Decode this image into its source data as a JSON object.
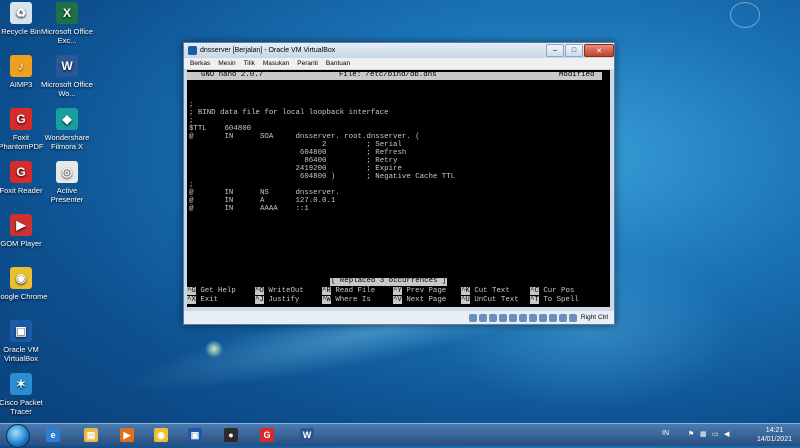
{
  "desktop": {
    "icons": [
      {
        "label": "Recycle Bin",
        "icon": "recycle-bin-icon",
        "color": "#d8e4ee",
        "glyph": "♻"
      },
      {
        "label": "Microsoft Office Exc...",
        "icon": "excel-icon",
        "color": "#1e7145",
        "glyph": "X"
      },
      {
        "label": "AIMP3",
        "icon": "aimp-icon",
        "color": "#f0a020",
        "glyph": "♪"
      },
      {
        "label": "Microsoft Office Wo...",
        "icon": "word-icon",
        "color": "#2b5797",
        "glyph": "W"
      },
      {
        "label": "Foxit PhantomPDF",
        "icon": "foxit-icon",
        "color": "#d62b2b",
        "glyph": "G"
      },
      {
        "label": "Wondershare Filmora X",
        "icon": "filmora-icon",
        "color": "#18a0a0",
        "glyph": "◆"
      },
      {
        "label": "Foxit Reader",
        "icon": "foxit-reader-icon",
        "color": "#d62b2b",
        "glyph": "G"
      },
      {
        "label": "Active Presenter",
        "icon": "active-presenter-icon",
        "color": "#e8e8e8",
        "glyph": "◎"
      },
      {
        "label": "GOM Player",
        "icon": "gom-player-icon",
        "color": "#d03030",
        "glyph": "▶"
      },
      {
        "label": "Google Chrome",
        "icon": "chrome-icon",
        "color": "#e8c030",
        "glyph": "◉"
      },
      {
        "label": "Oracle VM VirtualBox",
        "icon": "virtualbox-icon",
        "color": "#1c5aa8",
        "glyph": "▣"
      },
      {
        "label": "Cisco Packet Tracer",
        "icon": "packet-tracer-icon",
        "color": "#2a8fd0",
        "glyph": "✶"
      }
    ]
  },
  "window": {
    "title": "dnsserver [Berjalan] - Oracle VM VirtualBox",
    "menu": [
      "Berkas",
      "Mesin",
      "Tilik",
      "Masukan",
      "Peranti",
      "Bantuan"
    ],
    "host_key": "Right Ctrl"
  },
  "nano": {
    "version": "GNU nano 2.0.7",
    "file": "File: /etc/bind/db.dns",
    "state": "Modified",
    "lines": [
      ";",
      "; BIND data file for local loopback interface",
      ";",
      "$TTL    604800",
      "@       IN      SOA     dnsserver. root.dnsserver. (",
      "                              2         ; Serial",
      "                         604800         ; Refresh",
      "                          86400         ; Retry",
      "                        2419200         ; Expire",
      "                         604800 )       ; Negative Cache TTL",
      ";",
      "@       IN      NS      dnsserver.",
      "@       IN      A       127.0.0.1",
      "@       IN      AAAA    ::1"
    ],
    "status": "[ Replaced 3 occurrences ]",
    "help_row1": [
      {
        "key": "^G",
        "label": "Get Help"
      },
      {
        "key": "^O",
        "label": "WriteOut"
      },
      {
        "key": "^R",
        "label": "Read File"
      },
      {
        "key": "^Y",
        "label": "Prev Page"
      },
      {
        "key": "^K",
        "label": "Cut Text"
      },
      {
        "key": "^C",
        "label": "Cur Pos"
      }
    ],
    "help_row2": [
      {
        "key": "^X",
        "label": "Exit"
      },
      {
        "key": "^J",
        "label": "Justify"
      },
      {
        "key": "^W",
        "label": "Where Is"
      },
      {
        "key": "^V",
        "label": "Next Page"
      },
      {
        "key": "^U",
        "label": "UnCut Text"
      },
      {
        "key": "^T",
        "label": "To Spell"
      }
    ]
  },
  "taskbar": {
    "items": [
      {
        "icon": "internet-explorer-icon",
        "color": "#2a7fd4",
        "glyph": "e"
      },
      {
        "icon": "file-explorer-icon",
        "color": "#e8b84a",
        "glyph": "▤"
      },
      {
        "icon": "media-player-icon",
        "color": "#e07020",
        "glyph": "▶"
      },
      {
        "icon": "chrome-icon",
        "color": "#e8c030",
        "glyph": "◉"
      },
      {
        "icon": "virtualbox-icon",
        "color": "#1c5aa8",
        "glyph": "▣"
      },
      {
        "icon": "recorder-icon",
        "color": "#2a2a2a",
        "glyph": "●"
      },
      {
        "icon": "foxit-icon",
        "color": "#d62b2b",
        "glyph": "G"
      },
      {
        "icon": "word-icon",
        "color": "#2b5797",
        "glyph": "W"
      }
    ],
    "language": "IN",
    "time": "14:21",
    "date": "14/01/2021"
  }
}
